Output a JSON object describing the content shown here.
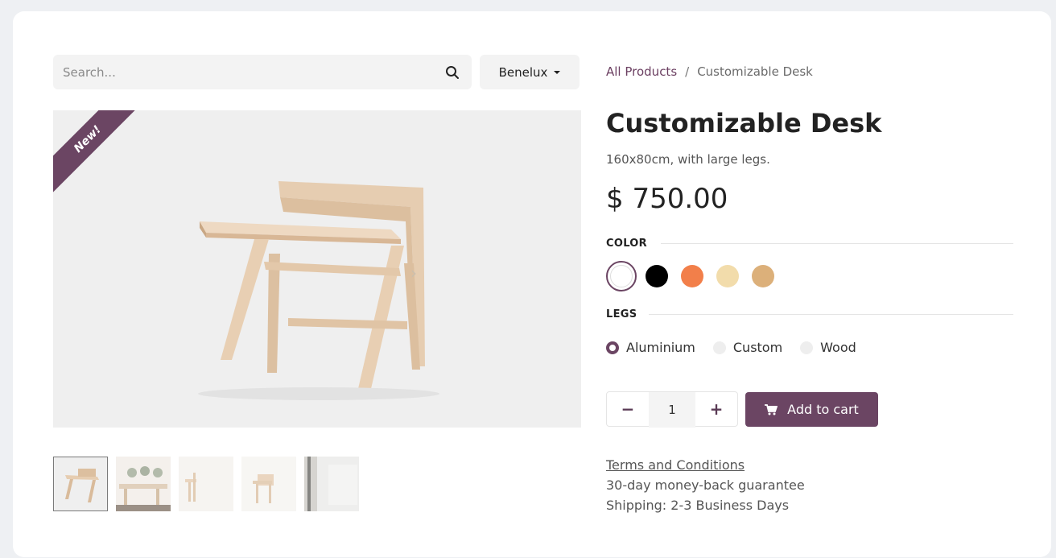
{
  "search": {
    "placeholder": "Search..."
  },
  "region": {
    "label": "Benelux"
  },
  "breadcrumb": {
    "parent": "All Products",
    "separator": "/",
    "current": "Customizable Desk"
  },
  "product": {
    "ribbon": "New!",
    "title": "Customizable Desk",
    "subtitle": "160x80cm, with large legs.",
    "price": "$ 750.00"
  },
  "attributes": {
    "color_label": "COLOR",
    "colors": [
      {
        "name": "white",
        "hex": "#ffffff",
        "selected": true
      },
      {
        "name": "black",
        "hex": "#000000",
        "selected": false
      },
      {
        "name": "orange",
        "hex": "#f27f4a",
        "selected": false
      },
      {
        "name": "beige",
        "hex": "#f2dcab",
        "selected": false
      },
      {
        "name": "tan",
        "hex": "#dcb07a",
        "selected": false
      }
    ],
    "legs_label": "LEGS",
    "legs": [
      {
        "label": "Aluminium",
        "checked": true
      },
      {
        "label": "Custom",
        "checked": false
      },
      {
        "label": "Wood",
        "checked": false
      }
    ]
  },
  "cart": {
    "minus": "−",
    "plus": "+",
    "quantity": "1",
    "add_label": "Add to cart"
  },
  "info": {
    "terms": "Terms and Conditions",
    "guarantee": "30-day money-back guarantee",
    "shipping": "Shipping: 2-3 Business Days"
  },
  "theme": {
    "accent": "#6b4563"
  }
}
